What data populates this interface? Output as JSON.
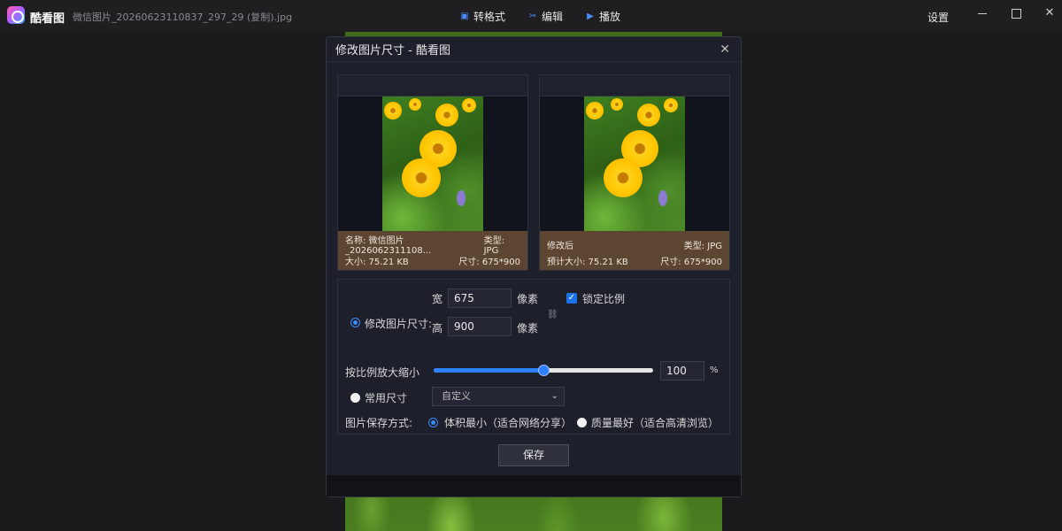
{
  "app": {
    "name": "酷看图",
    "file_name": "微信图片_20260623110837_297_29 (复制).jpg"
  },
  "toolbar": {
    "convert_label": "转格式",
    "edit_label": "编辑",
    "play_label": "播放",
    "settings_label": "设置"
  },
  "dialog": {
    "title": "修改图片尺寸 - 酷看图",
    "original": {
      "name_label": "名称: 微信图片_2026062311108...",
      "type_label": "类型: JPG",
      "size_label": "大小: 75.21 KB",
      "dimension_label": "尺寸: 675*900"
    },
    "modified": {
      "name_label": "修改后",
      "type_label": "类型: JPG",
      "size_label": "预计大小: 75.21 KB",
      "dimension_label": "尺寸: 675*900"
    },
    "resize": {
      "mode_label": "修改图片尺寸:",
      "width_label": "宽",
      "width_value": "675",
      "height_label": "高",
      "height_value": "900",
      "unit_label": "像素",
      "lock_ratio_label": "锁定比例",
      "lock_ratio_checked": true,
      "scale_label": "按比例放大缩小",
      "scale_value": "100",
      "scale_percent": 50,
      "percent_sign": "%",
      "preset_label": "常用尺寸",
      "preset_selected": "自定义",
      "save_mode_label": "图片保存方式:",
      "save_mode_small": "体积最小（适合网络分享）",
      "save_mode_best": "质量最好（适合高清浏览）"
    },
    "save_label": "保存"
  }
}
